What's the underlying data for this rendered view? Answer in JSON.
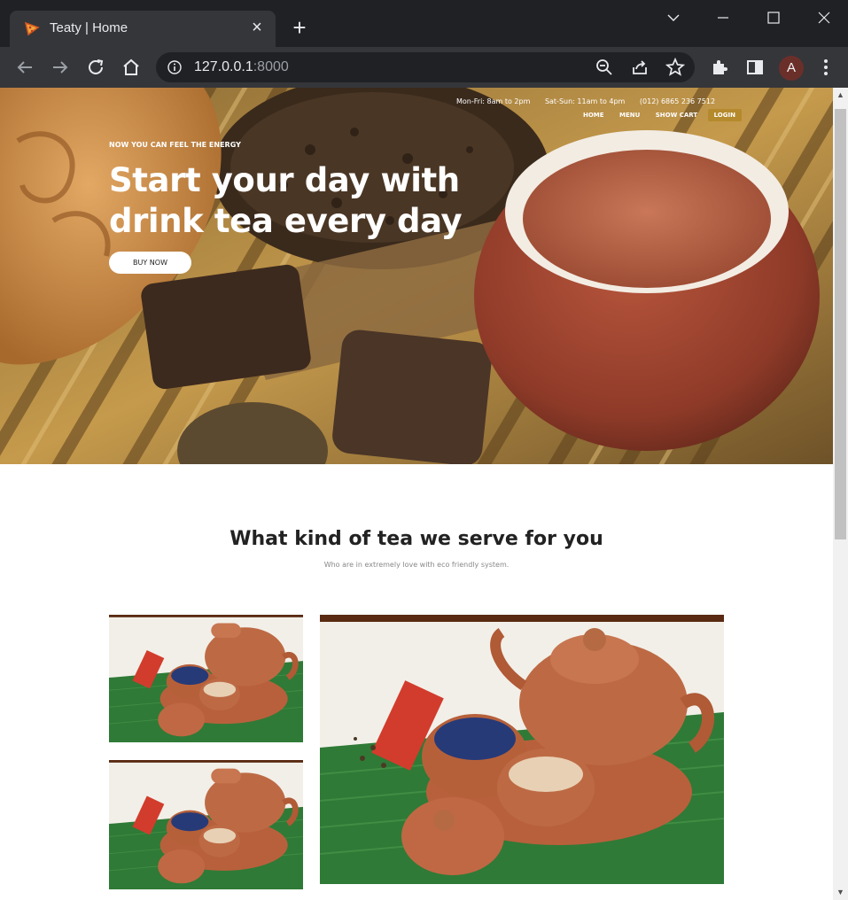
{
  "browser": {
    "tab_title": "Teaty | Home",
    "url_host": "127.0.0.1",
    "url_port": ":8000",
    "profile_initial": "A"
  },
  "hero": {
    "hours_weekday": "Mon-Fri: 8am to 2pm",
    "hours_weekend": "Sat-Sun: 11am to 4pm",
    "phone": "(012) 6865 236 7512",
    "nav": {
      "home": "HOME",
      "menu": "MENU",
      "cart": "SHOW CART",
      "login": "LOGIN"
    },
    "kicker": "NOW YOU CAN FEEL THE ENERGY",
    "title": "Start your day with drink tea every day",
    "button": "BUY NOW"
  },
  "section": {
    "title": "What kind of tea we serve for you",
    "subtitle": "Who are in extremely love with eco friendly system."
  },
  "colors": {
    "accent": "#b58a2c",
    "chrome_bg": "#202124",
    "toolbar_bg": "#35363a"
  }
}
